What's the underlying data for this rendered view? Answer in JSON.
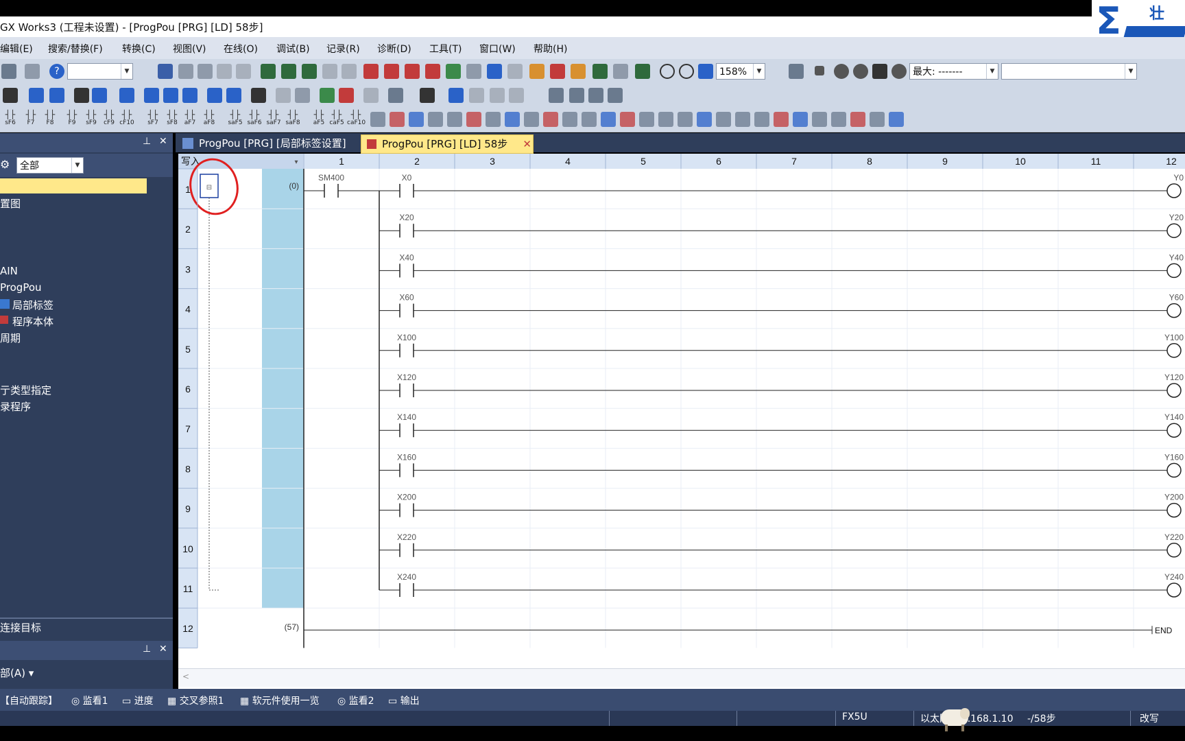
{
  "window": {
    "title": "GX Works3 (工程未设置) - [ProgPou [PRG] [LD] 58步]"
  },
  "logo": {
    "text": "壮"
  },
  "menu": [
    "编辑(E)",
    "搜索/替换(F)",
    "转换(C)",
    "视图(V)",
    "在线(O)",
    "调试(B)",
    "记录(R)",
    "诊断(D)",
    "工具(T)",
    "窗口(W)",
    "帮助(H)"
  ],
  "toolbar": {
    "zoom": "158%",
    "max_label": "最大: -------",
    "fkeys": [
      "sF6",
      "F7",
      "F8",
      "F9",
      "sF9",
      "cF9",
      "cF10",
      "sF7",
      "sF8",
      "aF7",
      "aF8",
      "saF5",
      "saF6",
      "saF7",
      "saF8",
      "aF5",
      "caF5",
      "caF10"
    ]
  },
  "nav": {
    "filter": "全部",
    "items": [
      "置图",
      "AIN",
      "ProgPou",
      "局部标签",
      "程序本体",
      "周期",
      "亍类型指定",
      "录程序"
    ],
    "connection": "连接目标",
    "bottom_filter": "部(A)"
  },
  "tabs": [
    {
      "label": "ProgPou [PRG] [局部标签设置]",
      "active": false
    },
    {
      "label": "ProgPou [PRG] [LD] 58步",
      "active": true
    }
  ],
  "ladder": {
    "mode": "写入",
    "columns": [
      "1",
      "2",
      "3",
      "4",
      "5",
      "6",
      "7",
      "8",
      "9",
      "10",
      "11",
      "12"
    ],
    "rows": [
      "1",
      "2",
      "3",
      "4",
      "5",
      "6",
      "7",
      "8",
      "9",
      "10",
      "11",
      "12"
    ],
    "step0": "(0)",
    "step_end": "(57)",
    "main_contact": "SM400",
    "contacts": [
      "X0",
      "X20",
      "X40",
      "X60",
      "X100",
      "X120",
      "X140",
      "X160",
      "X200",
      "X220",
      "X240"
    ],
    "coils": [
      "Y0",
      "Y20",
      "Y40",
      "Y60",
      "Y100",
      "Y120",
      "Y140",
      "Y160",
      "Y200",
      "Y220",
      "Y240"
    ],
    "end": "END"
  },
  "taskbar": [
    "【自动跟踪】",
    "监看1",
    "进度",
    "交叉参照1",
    "软元件使用一览",
    "监看2",
    "输出"
  ],
  "status": {
    "cpu": "FX5U",
    "conn": "以太网 ...2.168.1.10",
    "steps": "-/58步",
    "mode": "改写"
  }
}
